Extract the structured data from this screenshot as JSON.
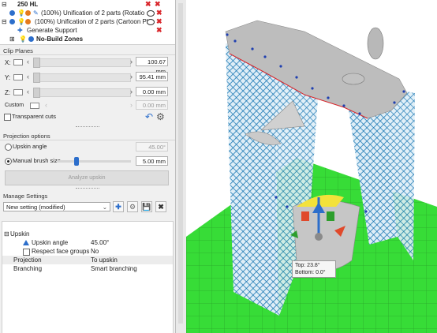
{
  "tree": {
    "root_label": "250 HL",
    "items": [
      {
        "label": "(100%) Unification of 2 parts (Rotatio"
      },
      {
        "label": "(100%) Unification of 2 parts (Cartoon Pl"
      },
      {
        "label": "Generate Support"
      },
      {
        "label": "No-Build Zones"
      }
    ]
  },
  "clip_planes": {
    "title": "Clip Planes",
    "rows": [
      {
        "axis": "X:",
        "value": "100.67 mm"
      },
      {
        "axis": "Y:",
        "value": "95.41 mm"
      },
      {
        "axis": "Z:",
        "value": "0.00 mm"
      },
      {
        "axis": "Custom",
        "value": "0.00 mm"
      }
    ],
    "transparent_cuts_label": "Transparent cuts"
  },
  "projection": {
    "title": "Projection options",
    "upskin_angle_label": "Upskin angle",
    "upskin_angle_value": "45.00°",
    "manual_brush_label": "Manual brush size",
    "manual_brush_value": "5.00 mm",
    "brush_level": 0.27,
    "analyze_label": "Analyze upskin"
  },
  "manage": {
    "title": "Manage Settings",
    "selected": "New setting (modified)"
  },
  "properties": {
    "group": "Upskin",
    "rows": [
      {
        "key": "Upskin angle",
        "value": "45.00°"
      },
      {
        "key": "Respect face groups",
        "value": "No"
      },
      {
        "key": "Projection",
        "value": "To upskin"
      },
      {
        "key": "Branching",
        "value": "Smart branching"
      }
    ]
  },
  "viewport": {
    "tooltip_top": "Top: 23.8°",
    "tooltip_bottom": "Bottom: 0.0°"
  },
  "colors": {
    "support_blue": "#1b78b4",
    "grid_green": "#37dc37",
    "model_gray": "#bdbdbd",
    "accent": "#2c6ecb",
    "delete_red": "#d9262b"
  }
}
